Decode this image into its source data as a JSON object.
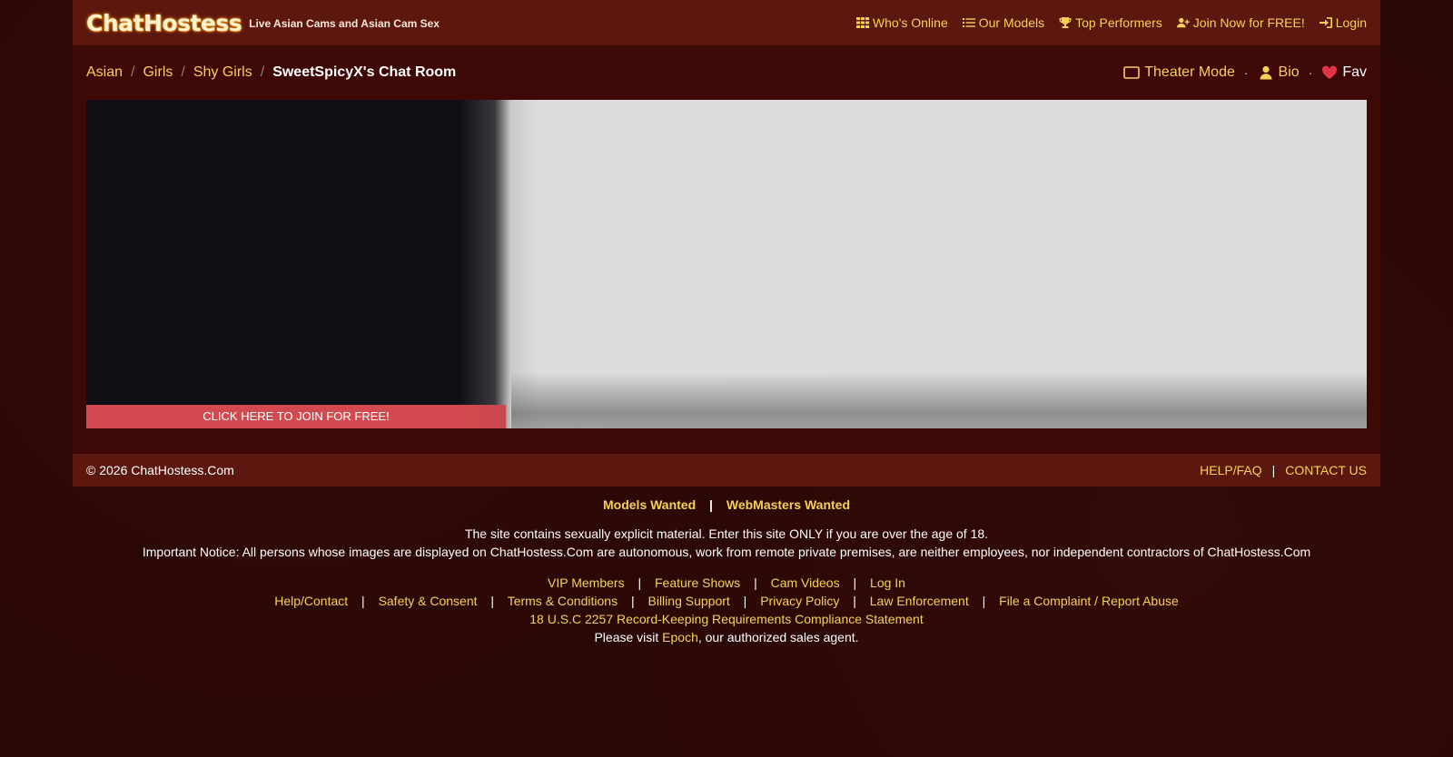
{
  "header": {
    "logo_text": "ChatHostess",
    "tagline": "Live Asian Cams and Asian Cam Sex",
    "nav": [
      {
        "label": "Who's Online",
        "icon": "grid-icon"
      },
      {
        "label": "Our Models",
        "icon": "list-icon"
      },
      {
        "label": "Top Performers",
        "icon": "trophy-icon"
      },
      {
        "label": "Join Now for FREE!",
        "icon": "user-plus-icon"
      },
      {
        "label": "Login",
        "icon": "sign-in-icon"
      }
    ]
  },
  "breadcrumb": {
    "items": [
      "Asian",
      "Girls",
      "Shy Girls"
    ],
    "separator": "/",
    "current": "SweetSpicyX's Chat Room"
  },
  "room_tools": {
    "theater_label": "Theater Mode",
    "bio_label": "Bio",
    "fav_label": "Fav",
    "separator": "·"
  },
  "player": {
    "join_button": "CLICK HERE TO JOIN FOR FREE!"
  },
  "footer": {
    "copyright": "© 2026 ChatHostess.Com",
    "help_label": "HELP/FAQ",
    "contact_label": "CONTACT US",
    "separator": "|"
  },
  "bottom": {
    "models_wanted": "Models Wanted",
    "webmasters_wanted": "WebMasters Wanted",
    "notice_line1": "The site contains sexually explicit material. Enter this site ONLY if you are over the age of 18.",
    "notice_line2": "Important Notice: All persons whose images are displayed on ChatHostess.Com are autonomous, work from remote private premises, are neither employees, nor independent contractors of ChatHostess.Com",
    "links_row1": [
      "VIP Members",
      "Feature Shows",
      "Cam Videos",
      "Log In"
    ],
    "links_row2": [
      "Help/Contact",
      "Safety & Consent",
      "Terms & Conditions",
      "Billing Support",
      "Privacy Policy",
      "Law Enforcement",
      "File a Complaint / Report Abuse"
    ],
    "compliance_link": "18 U.S.C 2257 Record-Keeping Requirements Compliance Statement",
    "visit_prefix": "Please visit ",
    "visit_link": "Epoch",
    "visit_suffix": ", our authorized sales agent."
  },
  "colors": {
    "accent": "#f7d154",
    "bar": "#5c170e",
    "panel": "#3e0806",
    "background": "#2a0806",
    "join_button": "#d24a4f",
    "heart": "#e0334a"
  }
}
